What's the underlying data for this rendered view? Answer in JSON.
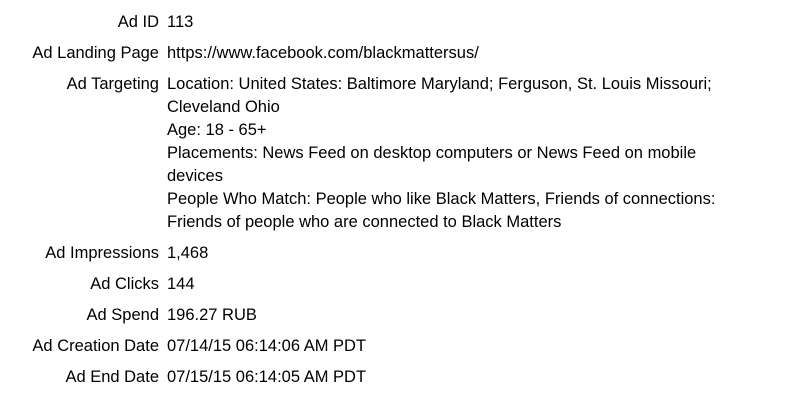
{
  "rows": {
    "ad_id": {
      "label": "Ad ID",
      "value": "113"
    },
    "landing_page": {
      "label": "Ad Landing Page",
      "value": "https://www.facebook.com/blackmattersus/"
    },
    "targeting": {
      "label": "Ad Targeting",
      "lines": [
        "Location: United States: Baltimore Maryland; Ferguson, St. Louis Missouri;",
        "Cleveland Ohio",
        "Age: 18 - 65+",
        "Placements: News Feed on desktop computers or News Feed on mobile",
        "devices",
        "People Who Match: People who like Black Matters, Friends of connections:",
        "Friends of people who are connected to Black Matters"
      ]
    },
    "impressions": {
      "label": "Ad Impressions",
      "value": "1,468"
    },
    "clicks": {
      "label": "Ad Clicks",
      "value": "144"
    },
    "spend": {
      "label": "Ad Spend",
      "value": "196.27 RUB"
    },
    "creation_date": {
      "label": "Ad Creation Date",
      "value": "07/14/15 06:14:06 AM PDT"
    },
    "end_date": {
      "label": "Ad End Date",
      "value": "07/15/15 06:14:05 AM PDT"
    }
  }
}
